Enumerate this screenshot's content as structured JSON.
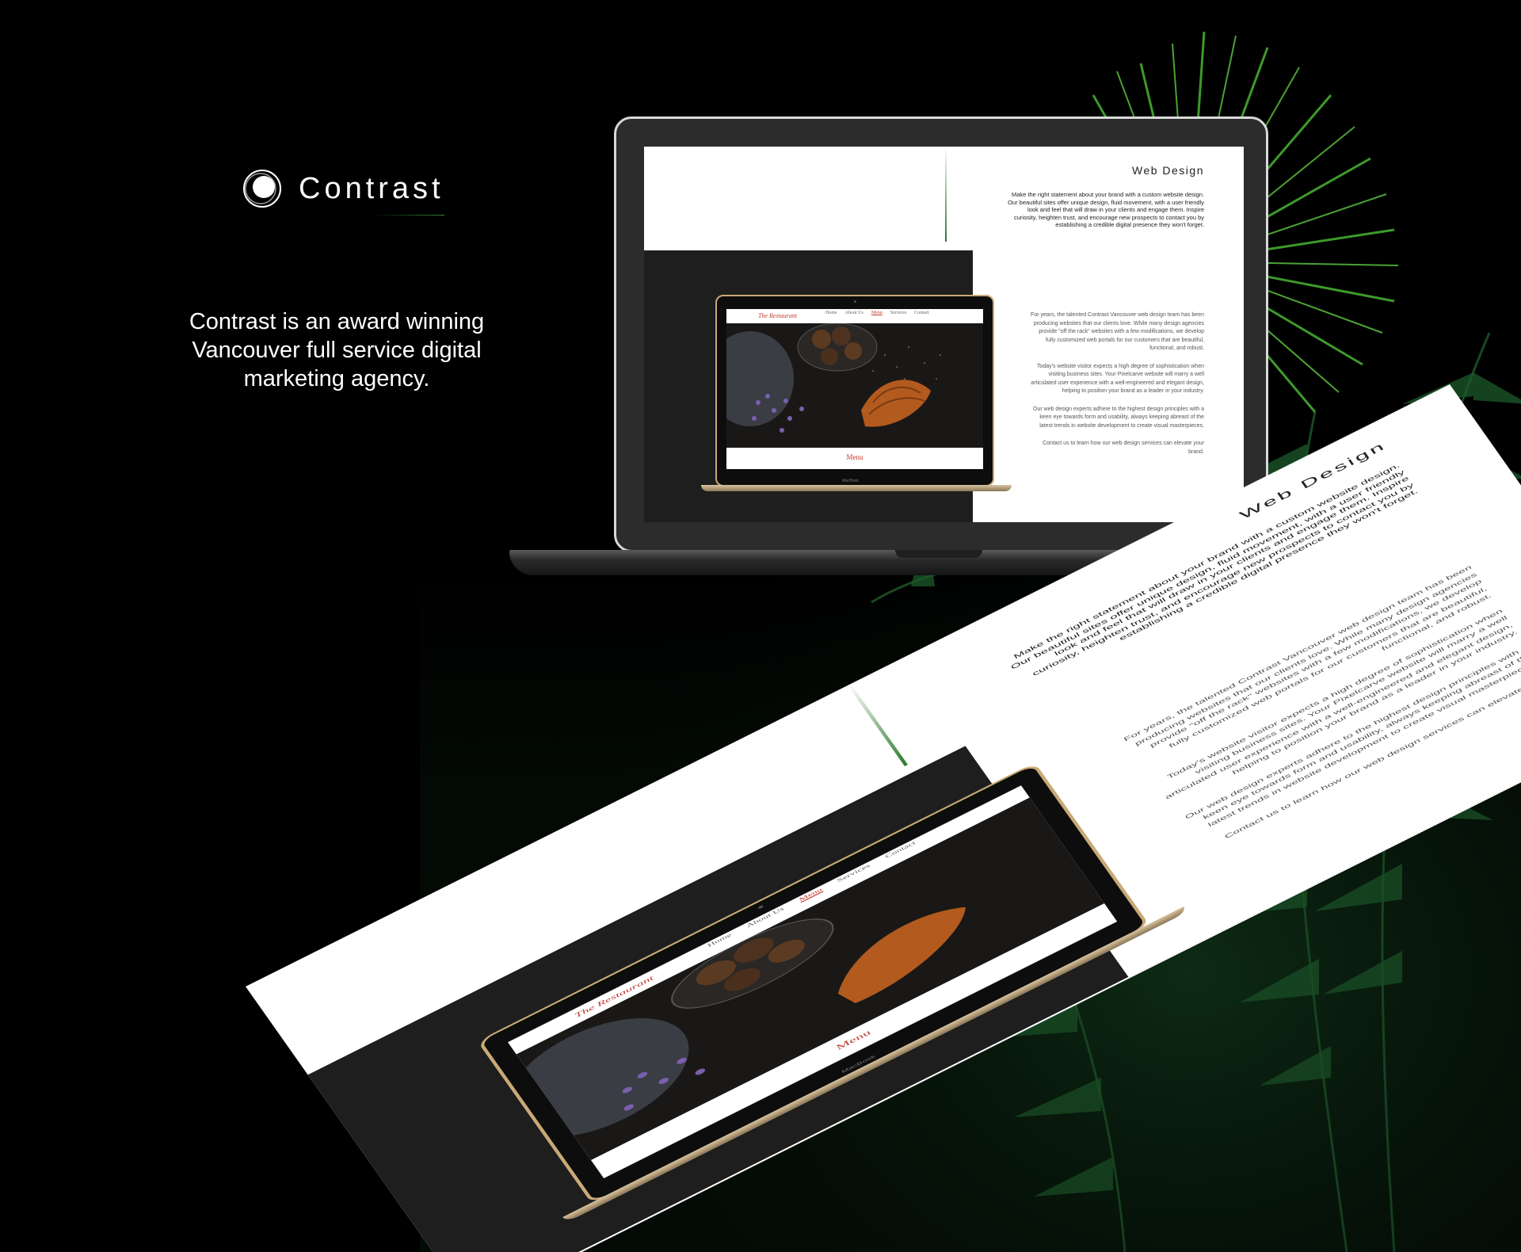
{
  "brand": {
    "name": "Contrast",
    "logo_icon": "contrast-logo-icon",
    "tagline": "Contrast is an award winning Vancouver full service digital marketing agency."
  },
  "colors": {
    "background": "#000000",
    "accent_green": "#2f8a2f",
    "restaurant_red": "#c0392b"
  },
  "mockup": {
    "title": "Web Design",
    "intro": "Make the right statement about your brand with a custom website design. Our beautiful sites offer unique design, fluid movement, with a user friendly look and feel that will draw in your clients and engage them. Inspire curiosity, heighten trust, and encourage new prospects to contact you by establishing a credible digital presence they won't forget.",
    "paragraphs": [
      "For years, the talented Contrast Vancouver web design team has been producing websites that our clients love. While many design agencies provide \"off the rack\" websites with a few modifications, we develop fully customized web portals for our customers that are beautiful, functional, and robust.",
      "Today's website visitor expects a high degree of sophistication when visiting business sites. Your Pixelcarve website will marry a well articulated user experience with a well-engineered and elegant design, helping to position your brand as a leader in your industry.",
      "Our web design experts adhere to the highest design principles with a keen eye towards form and usability, always keeping abreast of the latest trends in website development to create visual masterpieces.",
      "Contact us to learn how our web design services can elevate your brand."
    ]
  },
  "restaurant_site": {
    "brand": "The Restaurant",
    "nav": [
      "Home",
      "About Us",
      "Menu",
      "Services",
      "Contact"
    ],
    "active_nav": "Menu",
    "footer_heading": "Menu",
    "device_label": "MacBook"
  }
}
